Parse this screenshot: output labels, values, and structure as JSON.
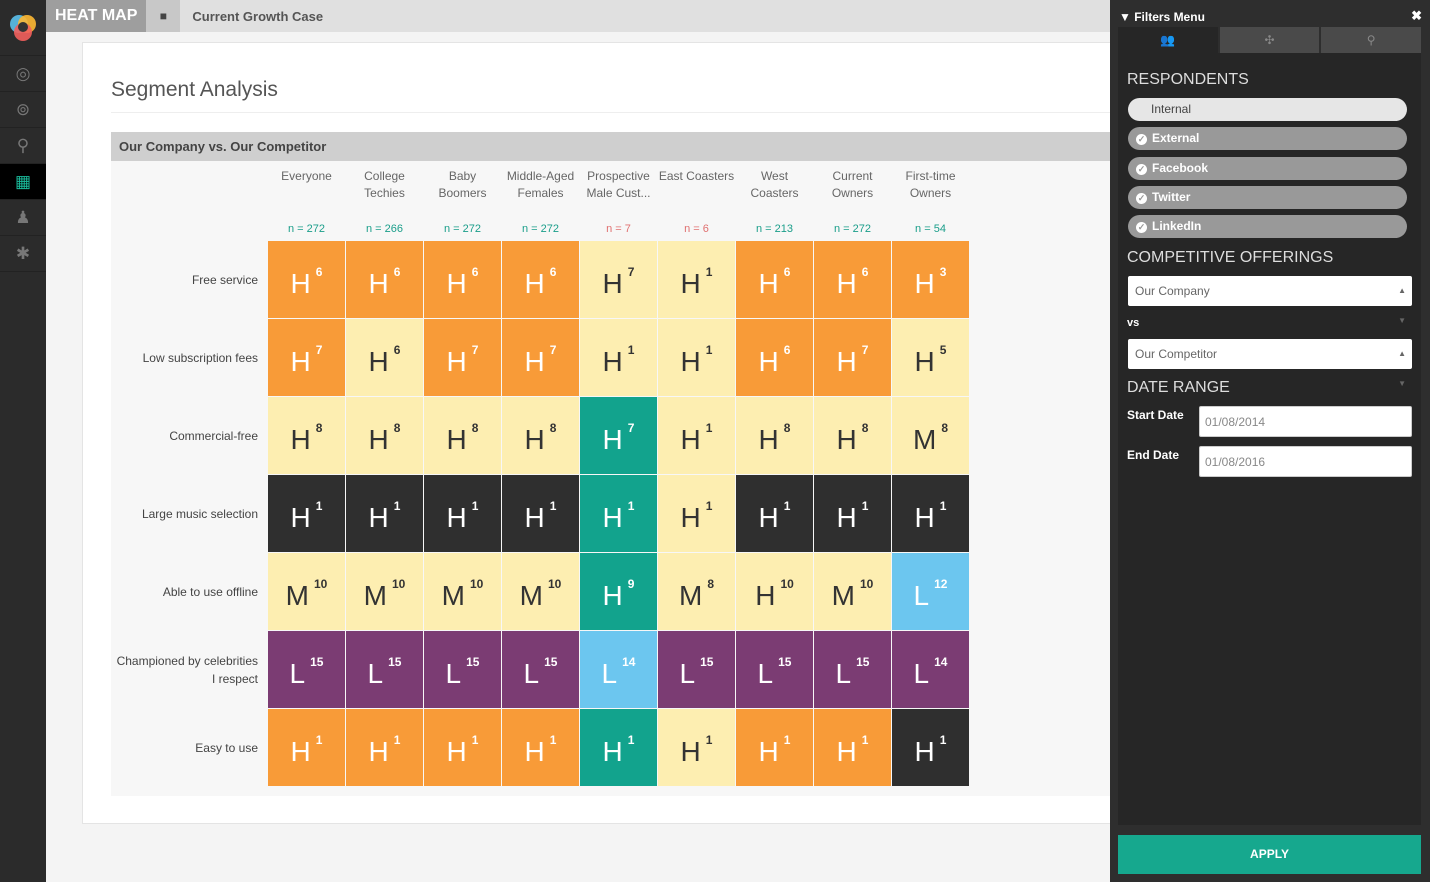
{
  "app": {
    "brand": "HEAT MAP",
    "case": "Current Growth Case"
  },
  "nav": [
    "compass-icon",
    "broadcast-icon",
    "location-icon",
    "grid-icon",
    "users-icon",
    "bug-icon"
  ],
  "page": {
    "title": "Segment Analysis",
    "table_title": "Our Company vs. Our Competitor"
  },
  "columns": [
    {
      "label": "Everyone",
      "n": "n = 272",
      "warn": false
    },
    {
      "label": "College Techies",
      "n": "n = 266",
      "warn": false
    },
    {
      "label": "Baby Boomers",
      "n": "n = 272",
      "warn": false
    },
    {
      "label": "Middle-Aged Females",
      "n": "n = 272",
      "warn": false
    },
    {
      "label": "Prospective Male Cust...",
      "n": "n = 7",
      "warn": true
    },
    {
      "label": "East Coasters",
      "n": "n = 6",
      "warn": true
    },
    {
      "label": "West Coasters",
      "n": "n = 213",
      "warn": false
    },
    {
      "label": "Current Owners",
      "n": "n = 272",
      "warn": false
    },
    {
      "label": "First-time Owners",
      "n": "n = 54",
      "warn": false
    }
  ],
  "rows": [
    {
      "label": "Free service",
      "cells": [
        [
          "H",
          "6",
          "o"
        ],
        [
          "H",
          "6",
          "o"
        ],
        [
          "H",
          "6",
          "o"
        ],
        [
          "H",
          "6",
          "o"
        ],
        [
          "H",
          "7",
          "y"
        ],
        [
          "H",
          "1",
          "y"
        ],
        [
          "H",
          "6",
          "o"
        ],
        [
          "H",
          "6",
          "o"
        ],
        [
          "H",
          "3",
          "o"
        ]
      ]
    },
    {
      "label": "Low subscription fees",
      "cells": [
        [
          "H",
          "7",
          "o"
        ],
        [
          "H",
          "6",
          "y"
        ],
        [
          "H",
          "7",
          "o"
        ],
        [
          "H",
          "7",
          "o"
        ],
        [
          "H",
          "1",
          "y"
        ],
        [
          "H",
          "1",
          "y"
        ],
        [
          "H",
          "6",
          "o"
        ],
        [
          "H",
          "7",
          "o"
        ],
        [
          "H",
          "5",
          "y"
        ]
      ]
    },
    {
      "label": "Commercial-free",
      "cells": [
        [
          "H",
          "8",
          "y"
        ],
        [
          "H",
          "8",
          "y"
        ],
        [
          "H",
          "8",
          "y"
        ],
        [
          "H",
          "8",
          "y"
        ],
        [
          "H",
          "7",
          "t"
        ],
        [
          "H",
          "1",
          "y"
        ],
        [
          "H",
          "8",
          "y"
        ],
        [
          "H",
          "8",
          "y"
        ],
        [
          "M",
          "8",
          "y"
        ]
      ]
    },
    {
      "label": "Large music selection",
      "cells": [
        [
          "H",
          "1",
          "d"
        ],
        [
          "H",
          "1",
          "d"
        ],
        [
          "H",
          "1",
          "d"
        ],
        [
          "H",
          "1",
          "d"
        ],
        [
          "H",
          "1",
          "t"
        ],
        [
          "H",
          "1",
          "y"
        ],
        [
          "H",
          "1",
          "d"
        ],
        [
          "H",
          "1",
          "d"
        ],
        [
          "H",
          "1",
          "d"
        ]
      ]
    },
    {
      "label": "Able to use offline",
      "cells": [
        [
          "M",
          "10",
          "y"
        ],
        [
          "M",
          "10",
          "y"
        ],
        [
          "M",
          "10",
          "y"
        ],
        [
          "M",
          "10",
          "y"
        ],
        [
          "H",
          "9",
          "t"
        ],
        [
          "M",
          "8",
          "y"
        ],
        [
          "H",
          "10",
          "y"
        ],
        [
          "M",
          "10",
          "y"
        ],
        [
          "L",
          "12",
          "b"
        ]
      ]
    },
    {
      "label": "Championed by celebrities I respect",
      "cells": [
        [
          "L",
          "15",
          "p"
        ],
        [
          "L",
          "15",
          "p"
        ],
        [
          "L",
          "15",
          "p"
        ],
        [
          "L",
          "15",
          "p"
        ],
        [
          "L",
          "14",
          "b"
        ],
        [
          "L",
          "15",
          "p"
        ],
        [
          "L",
          "15",
          "p"
        ],
        [
          "L",
          "15",
          "p"
        ],
        [
          "L",
          "14",
          "p"
        ]
      ]
    },
    {
      "label": "Easy to use",
      "cells": [
        [
          "H",
          "1",
          "o"
        ],
        [
          "H",
          "1",
          "o"
        ],
        [
          "H",
          "1",
          "o"
        ],
        [
          "H",
          "1",
          "o"
        ],
        [
          "H",
          "1",
          "t"
        ],
        [
          "H",
          "1",
          "y"
        ],
        [
          "H",
          "1",
          "o"
        ],
        [
          "H",
          "1",
          "o"
        ],
        [
          "H",
          "1",
          "d"
        ]
      ]
    }
  ],
  "colors": {
    "orange": "#f89b38",
    "yellow": "#fdeeb1",
    "teal": "#12a38d",
    "dark": "#2f2f2f",
    "blue": "#6cc6ef",
    "purple": "#7b3c73",
    "n_ok": "#1a9e8a",
    "n_warn": "#e07070"
  },
  "filters": {
    "title": "Filters Menu",
    "respondents_heading": "RESPONDENTS",
    "respondents": [
      {
        "label": "Internal",
        "checked": false
      },
      {
        "label": "External",
        "checked": true
      },
      {
        "label": "Facebook",
        "checked": true
      },
      {
        "label": "Twitter",
        "checked": true
      },
      {
        "label": "LinkedIn",
        "checked": true
      }
    ],
    "offerings_heading": "COMPETITIVE OFFERINGS",
    "offering_a": "Our Company",
    "vs": "vs",
    "offering_b": "Our Competitor",
    "date_heading": "DATE RANGE",
    "start_label": "Start Date",
    "start": "01/08/2014",
    "end_label": "End Date",
    "end": "01/08/2016",
    "apply": "APPLY"
  }
}
